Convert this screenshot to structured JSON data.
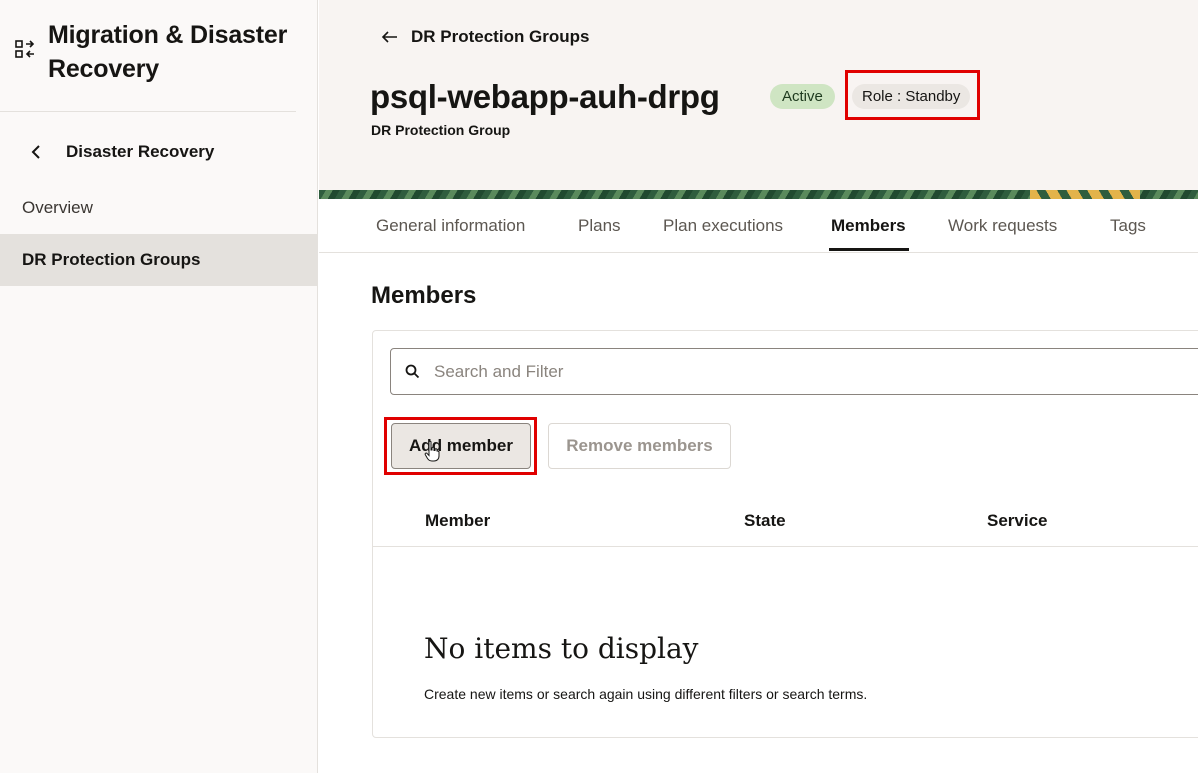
{
  "app": {
    "title": "Migration & Disaster Recovery",
    "icon": "migration-icon"
  },
  "sidebar": {
    "back_label": "Disaster Recovery",
    "items": [
      {
        "label": "Overview",
        "selected": false
      },
      {
        "label": "DR Protection Groups",
        "selected": true
      }
    ]
  },
  "header": {
    "breadcrumb": "DR Protection Groups",
    "title": "psql-webapp-auh-drpg",
    "subtitle": "DR Protection Group",
    "status_badge": "Active",
    "role_badge": "Role : Standby",
    "colors": {
      "status_bg": "#cfe5c3",
      "highlight": "#e00000"
    }
  },
  "tabs": [
    {
      "label": "General information",
      "active": false
    },
    {
      "label": "Plans",
      "active": false
    },
    {
      "label": "Plan executions",
      "active": false
    },
    {
      "label": "Members",
      "active": true
    },
    {
      "label": "Work requests",
      "active": false
    },
    {
      "label": "Tags",
      "active": false
    }
  ],
  "members": {
    "section_title": "Members",
    "search_placeholder": "Search and Filter",
    "add_button": "Add member",
    "remove_button": "Remove members",
    "columns": [
      "Member",
      "State",
      "Service"
    ],
    "empty_title": "No items to display",
    "empty_text": "Create new items or search again using different filters or search terms."
  }
}
